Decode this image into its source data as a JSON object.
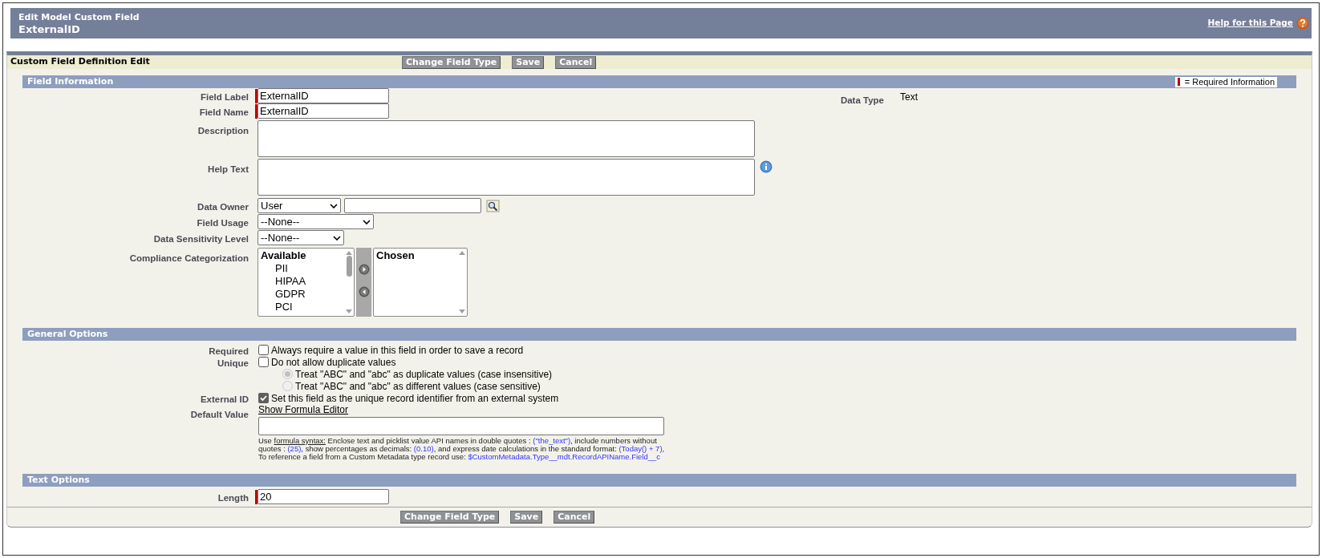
{
  "header": {
    "subtitle": "Edit Model Custom Field",
    "title": "ExternalID",
    "help_link": "Help for this Page"
  },
  "edit_bar": {
    "title": "Custom Field Definition Edit",
    "buttons": [
      "Change Field Type",
      "Save",
      "Cancel"
    ]
  },
  "field_information": {
    "title": "Field Information",
    "required_legend": "= Required Information",
    "data_type": {
      "label": "Data Type",
      "value": "Text"
    },
    "fields": [
      {
        "kind": "text",
        "label": "Field Label",
        "value": "ExternalID",
        "required": true
      },
      {
        "kind": "text",
        "label": "Field Name",
        "value": "ExternalID",
        "required": true
      },
      {
        "kind": "textarea",
        "label": "Description",
        "help_icon": false
      },
      {
        "kind": "textarea",
        "label": "Help Text",
        "help_icon": true
      },
      {
        "kind": "lookup",
        "label": "Data Owner",
        "value": "User"
      },
      {
        "kind": "select_wide",
        "label": "Field Usage",
        "value": "--None--"
      },
      {
        "kind": "select",
        "label": "Data Sensitivity Level",
        "value": "--None--"
      },
      {
        "kind": "dual_list",
        "label": "Compliance Categorization",
        "available_heading": "Available",
        "available": [
          {
            "label": "PII",
            "selected": false
          },
          {
            "label": "HIPAA",
            "selected": false
          },
          {
            "label": "GDPR",
            "selected": false
          },
          {
            "label": "PCI",
            "selected": false
          }
        ],
        "chosen_heading": "Chosen"
      }
    ]
  },
  "general_options": {
    "title": "General Options",
    "rows": [
      {
        "kind": "checkbox",
        "label": "Required",
        "text": "Always require a value in this field in order to save a record",
        "checked": false
      },
      {
        "kind": "checkbox",
        "label": "Unique",
        "text": "Do not allow duplicate values",
        "checked": false
      },
      {
        "kind": "radio",
        "text": "Treat \"ABC\" and \"abc\" as duplicate values (case insensitive)",
        "selected": true,
        "disabled": true
      },
      {
        "kind": "radio",
        "text": "Treat \"ABC\" and \"abc\" as different values (case sensitive)",
        "selected": false,
        "disabled": true
      },
      {
        "kind": "checkbox",
        "label": "External ID",
        "text": "Set this field as the unique record identifier from an external system",
        "checked": true
      },
      {
        "kind": "formula",
        "label": "Default Value",
        "link": "Show Formula Editor",
        "hint": [
          {
            "kind": "plain",
            "text": "Use "
          },
          {
            "kind": "link",
            "text": "formula syntax:"
          },
          {
            "kind": "plain",
            "text": " Enclose text and picklist value API names in double quotes : "
          },
          {
            "kind": "code",
            "text": "(\"the_text\")"
          },
          {
            "kind": "plain",
            "text": ", include numbers without quotes : "
          },
          {
            "kind": "code",
            "text": "(25)"
          },
          {
            "kind": "plain",
            "text": ", show percentages as decimals: "
          },
          {
            "kind": "code",
            "text": "(0.10)"
          },
          {
            "kind": "plain",
            "text": ", and express date calculations in the standard format: "
          },
          {
            "kind": "code",
            "text": "(Today() + 7)"
          },
          {
            "kind": "plain",
            "text": ", To reference a field from a Custom Metadata type record use: "
          },
          {
            "kind": "code",
            "text": "$CustomMetadata.Type__mdt.RecordAPIName.Field__c"
          }
        ]
      }
    ]
  },
  "text_options": {
    "title": "Text Options",
    "fields": [
      {
        "kind": "text",
        "label": "Length",
        "value": "20",
        "required": true
      }
    ]
  },
  "footer_buttons": [
    "Change Field Type",
    "Save",
    "Cancel"
  ]
}
